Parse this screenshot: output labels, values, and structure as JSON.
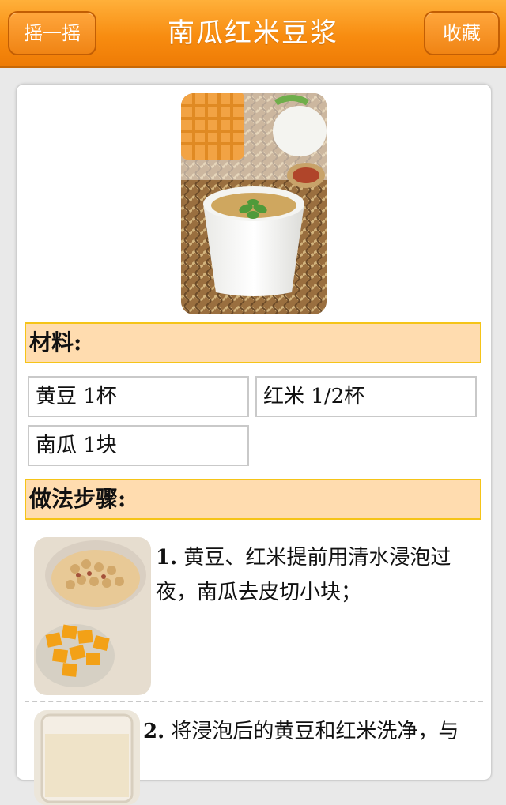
{
  "header": {
    "title": "南瓜红米豆浆",
    "left_button": "摇一摇",
    "right_button": "收藏"
  },
  "materials": {
    "heading": "材料:",
    "items": [
      "黄豆 1杯",
      "红米 1/2杯",
      "南瓜 1块"
    ]
  },
  "steps": {
    "heading": "做法步骤:",
    "items": [
      {
        "num": "1.",
        "text": "黄豆、红米提前用清水浸泡过夜，南瓜去皮切小块；"
      },
      {
        "num": "2.",
        "text": "将浸泡后的黄豆和红米洗净，与"
      }
    ]
  },
  "colors": {
    "header_orange": "#f88c10",
    "section_fill": "#ffdcaf",
    "section_border": "#f5c418"
  }
}
